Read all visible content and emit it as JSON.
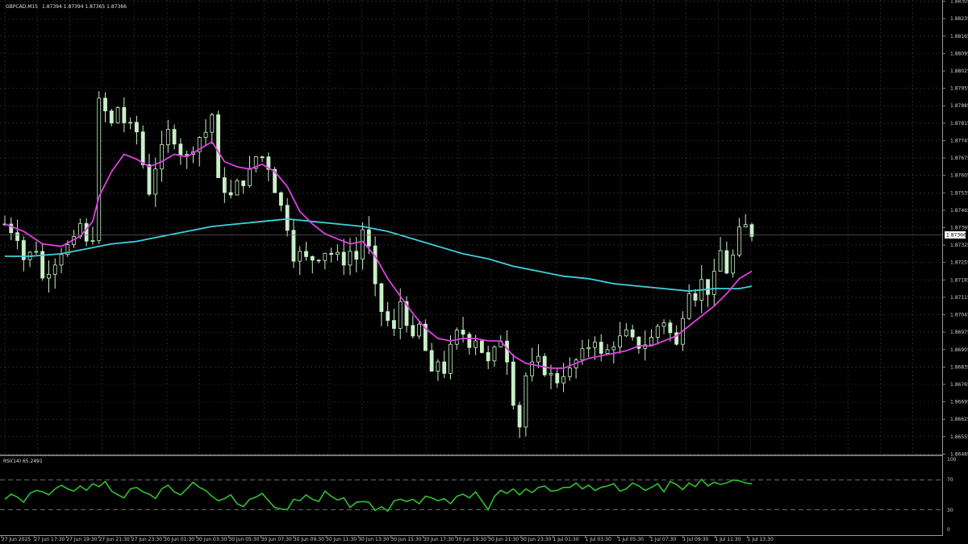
{
  "header": {
    "symbol": "GBPCAD,M15",
    "ohlc": "1.87394 1.87394 1.87365 1.87366"
  },
  "price_label": "1.87366",
  "rsi": {
    "label": "RSI(14) 65.2491",
    "scale_labels": [
      "100",
      "70",
      "30",
      "0"
    ]
  },
  "colors": {
    "background": "#000000",
    "grid": "#3a3a3a",
    "candle": "#c8f0c8",
    "ma_fast": "#e040e0",
    "ma_slow": "#40d0e0",
    "rsi_line": "#30c030",
    "axis": "#9a9a9a"
  },
  "chart_data": [
    {
      "type": "candlestick",
      "title": "GBPCAD,M15",
      "ylim": [
        1.8648,
        1.8831
      ],
      "y_ticks": [
        "1.88305",
        "1.88235",
        "1.88165",
        "1.88095",
        "1.88025",
        "1.87955",
        "1.87885",
        "1.87815",
        "1.87745",
        "1.87675",
        "1.87605",
        "1.87535",
        "1.87465",
        "1.87395",
        "1.87325",
        "1.87255",
        "1.87185",
        "1.87115",
        "1.87045",
        "1.86975",
        "1.86905",
        "1.86835",
        "1.86765",
        "1.86695",
        "1.86625",
        "1.86555",
        "1.86485"
      ],
      "x_labels": [
        "27 Jun 2025",
        "27 Jun 17:30",
        "27 Jun 19:30",
        "27 Jun 21:30",
        "27 Jun 23:30",
        "30 Jun 01:30",
        "30 Jun 03:30",
        "30 Jun 05:30",
        "30 Jun 07:30",
        "30 Jun 09:30",
        "30 Jun 11:30",
        "30 Jun 13:30",
        "30 Jun 15:30",
        "30 Jun 17:30",
        "30 Jun 19:30",
        "30 Jun 21:30",
        "30 Jun 23:30",
        "1 Jul 01:30",
        "1 Jul 03:30",
        "1 Jul 05:30",
        "1 Jul 07:30",
        "1 Jul 09:30",
        "1 Jul 11:30",
        "1 Jul 13:30"
      ],
      "close_path": [
        [
          0,
          1.8741
        ],
        [
          2,
          1.8736
        ],
        [
          3,
          1.8727
        ],
        [
          5,
          1.8731
        ],
        [
          6,
          1.8719
        ],
        [
          8,
          1.8726
        ],
        [
          9,
          1.873
        ],
        [
          11,
          1.8734
        ],
        [
          12,
          1.8741
        ],
        [
          13,
          1.8733
        ],
        [
          14,
          1.8736
        ],
        [
          15,
          1.879
        ],
        [
          16,
          1.8786
        ],
        [
          17,
          1.8781
        ],
        [
          18,
          1.8788
        ],
        [
          19,
          1.8782
        ],
        [
          20,
          1.878
        ],
        [
          21,
          1.8778
        ],
        [
          22,
          1.8765
        ],
        [
          23,
          1.8754
        ],
        [
          24,
          1.8764
        ],
        [
          25,
          1.8771
        ],
        [
          26,
          1.8778
        ],
        [
          27,
          1.8775
        ],
        [
          28,
          1.877
        ],
        [
          29,
          1.8768
        ],
        [
          30,
          1.8772
        ],
        [
          31,
          1.8776
        ],
        [
          32,
          1.8778
        ],
        [
          33,
          1.8785
        ],
        [
          34,
          1.8758
        ],
        [
          35,
          1.8755
        ],
        [
          36,
          1.8752
        ],
        [
          37,
          1.8757
        ],
        [
          38,
          1.8758
        ],
        [
          39,
          1.8762
        ],
        [
          40,
          1.8768
        ],
        [
          41,
          1.8768
        ],
        [
          42,
          1.8764
        ],
        [
          43,
          1.8755
        ],
        [
          44,
          1.8748
        ],
        [
          45,
          1.874
        ],
        [
          46,
          1.8728
        ],
        [
          47,
          1.8729
        ],
        [
          48,
          1.8727
        ],
        [
          49,
          1.8727
        ],
        [
          50,
          1.8728
        ],
        [
          51,
          1.873
        ],
        [
          52,
          1.8729
        ],
        [
          53,
          1.8728
        ],
        [
          54,
          1.8726
        ],
        [
          55,
          1.873
        ],
        [
          56,
          1.8727
        ],
        [
          57,
          1.8739
        ],
        [
          58,
          1.8731
        ],
        [
          59,
          1.8715
        ],
        [
          60,
          1.8706
        ],
        [
          61,
          1.8702
        ],
        [
          62,
          1.8698
        ],
        [
          63,
          1.871
        ],
        [
          64,
          1.8702
        ],
        [
          65,
          1.8694
        ],
        [
          66,
          1.87
        ],
        [
          67,
          1.869
        ],
        [
          68,
          1.868
        ],
        [
          69,
          1.8686
        ],
        [
          70,
          1.8682
        ],
        [
          71,
          1.8691
        ],
        [
          72,
          1.8697
        ],
        [
          73,
          1.8697
        ],
        [
          74,
          1.8693
        ],
        [
          75,
          1.8695
        ],
        [
          76,
          1.869
        ],
        [
          77,
          1.8685
        ],
        [
          78,
          1.869
        ],
        [
          79,
          1.8695
        ],
        [
          80,
          1.8687
        ],
        [
          81,
          1.867
        ],
        [
          82,
          1.866
        ],
        [
          83,
          1.868
        ],
        [
          84,
          1.8684
        ],
        [
          85,
          1.8686
        ],
        [
          86,
          1.8682
        ],
        [
          87,
          1.868
        ],
        [
          88,
          1.8678
        ],
        [
          89,
          1.8681
        ],
        [
          90,
          1.8682
        ],
        [
          91,
          1.8686
        ],
        [
          92,
          1.8689
        ],
        [
          93,
          1.8692
        ],
        [
          94,
          1.8695
        ],
        [
          95,
          1.8688
        ],
        [
          96,
          1.869
        ],
        [
          97,
          1.8693
        ],
        [
          98,
          1.8695
        ],
        [
          99,
          1.8697
        ],
        [
          100,
          1.8694
        ],
        [
          101,
          1.8692
        ],
        [
          102,
          1.8693
        ],
        [
          103,
          1.8695
        ],
        [
          104,
          1.87
        ],
        [
          105,
          1.8702
        ],
        [
          106,
          1.8697
        ],
        [
          107,
          1.8692
        ],
        [
          108,
          1.8705
        ],
        [
          109,
          1.8715
        ],
        [
          110,
          1.8712
        ],
        [
          111,
          1.8718
        ],
        [
          112,
          1.8714
        ],
        [
          113,
          1.872
        ],
        [
          114,
          1.873
        ],
        [
          115,
          1.8722
        ],
        [
          116,
          1.8728
        ],
        [
          117,
          1.8738
        ],
        [
          118,
          1.874
        ],
        [
          119,
          1.8737
        ]
      ],
      "ma_fast": [
        [
          0,
          1.8741
        ],
        [
          3,
          1.8738
        ],
        [
          6,
          1.8733
        ],
        [
          9,
          1.8732
        ],
        [
          12,
          1.8736
        ],
        [
          14,
          1.8742
        ],
        [
          15,
          1.8752
        ],
        [
          17,
          1.8762
        ],
        [
          19,
          1.8769
        ],
        [
          21,
          1.8767
        ],
        [
          23,
          1.8764
        ],
        [
          25,
          1.8766
        ],
        [
          27,
          1.8769
        ],
        [
          29,
          1.8768
        ],
        [
          31,
          1.8771
        ],
        [
          33,
          1.8774
        ],
        [
          35,
          1.8766
        ],
        [
          37,
          1.8764
        ],
        [
          39,
          1.8763
        ],
        [
          41,
          1.8765
        ],
        [
          43,
          1.8762
        ],
        [
          45,
          1.8756
        ],
        [
          47,
          1.8746
        ],
        [
          49,
          1.8741
        ],
        [
          51,
          1.8737
        ],
        [
          53,
          1.8735
        ],
        [
          55,
          1.8733
        ],
        [
          57,
          1.8734
        ],
        [
          59,
          1.8728
        ],
        [
          61,
          1.8719
        ],
        [
          63,
          1.8712
        ],
        [
          65,
          1.8705
        ],
        [
          67,
          1.8699
        ],
        [
          69,
          1.8695
        ],
        [
          71,
          1.8694
        ],
        [
          73,
          1.8695
        ],
        [
          75,
          1.8695
        ],
        [
          77,
          1.8694
        ],
        [
          79,
          1.8694
        ],
        [
          81,
          1.8688
        ],
        [
          83,
          1.8685
        ],
        [
          85,
          1.8684
        ],
        [
          87,
          1.8683
        ],
        [
          89,
          1.8683
        ],
        [
          91,
          1.8685
        ],
        [
          93,
          1.8687
        ],
        [
          95,
          1.8688
        ],
        [
          97,
          1.8689
        ],
        [
          99,
          1.869
        ],
        [
          101,
          1.8692
        ],
        [
          103,
          1.8692
        ],
        [
          105,
          1.8694
        ],
        [
          107,
          1.8696
        ],
        [
          109,
          1.87
        ],
        [
          111,
          1.8704
        ],
        [
          113,
          1.8708
        ],
        [
          115,
          1.8713
        ],
        [
          117,
          1.8719
        ],
        [
          119,
          1.8722
        ]
      ],
      "ma_slow": [
        [
          0,
          1.8728
        ],
        [
          4,
          1.8728
        ],
        [
          9,
          1.8729
        ],
        [
          13,
          1.8731
        ],
        [
          17,
          1.8733
        ],
        [
          21,
          1.8734
        ],
        [
          25,
          1.8736
        ],
        [
          29,
          1.8738
        ],
        [
          33,
          1.874
        ],
        [
          37,
          1.8741
        ],
        [
          41,
          1.8742
        ],
        [
          45,
          1.8743
        ],
        [
          49,
          1.8742
        ],
        [
          53,
          1.8741
        ],
        [
          57,
          1.874
        ],
        [
          61,
          1.8738
        ],
        [
          65,
          1.8735
        ],
        [
          69,
          1.8732
        ],
        [
          73,
          1.8729
        ],
        [
          77,
          1.8727
        ],
        [
          81,
          1.8724
        ],
        [
          85,
          1.8722
        ],
        [
          89,
          1.872
        ],
        [
          93,
          1.8719
        ],
        [
          97,
          1.8717
        ],
        [
          101,
          1.8716
        ],
        [
          105,
          1.8715
        ],
        [
          109,
          1.8714
        ],
        [
          113,
          1.8715
        ],
        [
          117,
          1.8715
        ],
        [
          119,
          1.8716
        ]
      ]
    },
    {
      "type": "line",
      "title": "RSI(14) 65.2491",
      "ylim": [
        0,
        100
      ],
      "levels": [
        70,
        30
      ],
      "x_labels": [],
      "values": [
        44,
        51,
        47,
        40,
        52,
        56,
        54,
        50,
        58,
        63,
        58,
        55,
        62,
        56,
        65,
        61,
        68,
        55,
        50,
        46,
        58,
        60,
        54,
        51,
        45,
        58,
        63,
        54,
        50,
        58,
        67,
        60,
        56,
        48,
        42,
        45,
        50,
        38,
        34,
        44,
        47,
        52,
        42,
        33,
        31,
        30,
        44,
        42,
        50,
        44,
        41,
        55,
        48,
        43,
        46,
        33,
        40,
        41,
        40,
        29,
        34,
        28,
        42,
        44,
        41,
        44,
        38,
        48,
        46,
        42,
        45,
        38,
        48,
        51,
        46,
        54,
        42,
        30,
        48,
        56,
        52,
        58,
        50,
        58,
        53,
        60,
        62,
        55,
        56,
        60,
        60,
        66,
        58,
        63,
        56,
        60,
        62,
        65,
        55,
        58,
        66,
        62,
        56,
        60,
        65,
        54,
        68,
        64,
        57,
        66,
        61,
        71,
        62,
        67,
        64,
        66,
        70,
        69,
        66,
        65
      ]
    }
  ]
}
